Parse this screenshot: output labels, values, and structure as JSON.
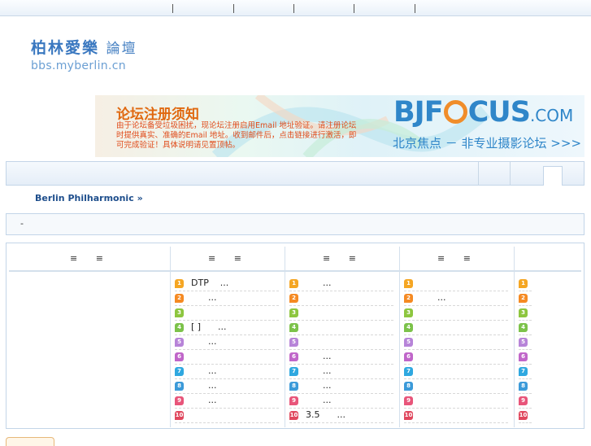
{
  "topbar": {
    "separators": 5
  },
  "logo": {
    "line1_a": "柏林愛樂",
    "line1_b": "論壇",
    "url": "bbs.myberlin.cn"
  },
  "banner": {
    "notice_title": "论坛注册须知",
    "notice_body": "由于论坛备受垃圾困扰，现论坛注册启用Email 地址验证。请注册论坛时提供真实、准确的Email 地址。收到邮件后，点击链接进行激活，即可完成验证！具体说明请见置顶帖。",
    "brand_a": "BJF",
    "brand_b": "CUS",
    "brand_com": ".COM",
    "slogan": "北京焦点 － 非专业摄影论坛 >>>"
  },
  "breadcrumb": {
    "text": "Berlin Philharmonic",
    "arrow": "»"
  },
  "infobar": {
    "text": "-"
  },
  "columns": [
    {
      "header": "≡   ≡",
      "rows": []
    },
    {
      "header": "≡   ≡",
      "rows": [
        "DTP    ...",
        "      ...",
        "",
        "[ ]      ...",
        "      ...",
        "",
        "      ...",
        "      ...",
        "      ...",
        ""
      ]
    },
    {
      "header": "≡   ≡",
      "rows": [
        "      ...",
        "",
        "",
        "",
        "",
        "      ...",
        "      ...",
        "      ...",
        "      ...",
        "3.5      ..."
      ]
    },
    {
      "header": "≡   ≡",
      "rows": [
        "",
        "      ...",
        "",
        "",
        "",
        "",
        "",
        "",
        "",
        ""
      ]
    },
    {
      "header": "",
      "rows": [
        "",
        "",
        "",
        "",
        "",
        "",
        "",
        "",
        "",
        ""
      ]
    }
  ],
  "rank_numbers": [
    "1",
    "2",
    "3",
    "4",
    "5",
    "6",
    "7",
    "8",
    "9",
    "10"
  ],
  "rank_colors": [
    "#f5a623",
    "#f58a23",
    "#8dc63f",
    "#7cc24a",
    "#b784d8",
    "#c066c9",
    "#2fa8e0",
    "#3b9ad9",
    "#e8557a",
    "#e0485e"
  ]
}
